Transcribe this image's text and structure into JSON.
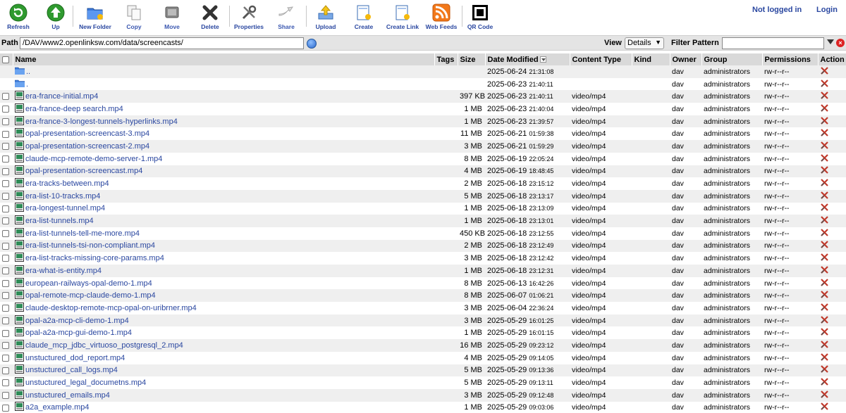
{
  "toolbar": {
    "buttons": [
      {
        "id": "refresh",
        "label": "Refresh",
        "icon": "refresh-icon"
      },
      {
        "id": "up",
        "label": "Up",
        "icon": "up-arrow-icon"
      },
      {
        "id": "new-folder",
        "label": "New Folder",
        "icon": "new-folder-icon"
      },
      {
        "id": "copy",
        "label": "Copy",
        "icon": "copy-icon"
      },
      {
        "id": "move",
        "label": "Move",
        "icon": "move-icon"
      },
      {
        "id": "delete",
        "label": "Delete",
        "icon": "delete-icon"
      },
      {
        "id": "properties",
        "label": "Properties",
        "icon": "properties-icon"
      },
      {
        "id": "share",
        "label": "Share",
        "icon": "share-icon"
      },
      {
        "id": "upload",
        "label": "Upload",
        "icon": "upload-icon"
      },
      {
        "id": "create",
        "label": "Create",
        "icon": "create-file-icon"
      },
      {
        "id": "create-link",
        "label": "Create Link",
        "icon": "create-link-icon"
      },
      {
        "id": "web-feeds",
        "label": "Web Feeds",
        "icon": "rss-icon"
      },
      {
        "id": "qr-code",
        "label": "QR Code",
        "icon": "qr-code-icon"
      }
    ],
    "not_logged_in": "Not logged in",
    "login": "Login"
  },
  "pathbar": {
    "path_label": "Path",
    "path_value": "/DAV/www2.openlinksw.com/data/screencasts/",
    "view_label": "View",
    "view_value": "Details",
    "filter_label": "Filter Pattern",
    "filter_value": ""
  },
  "columns": {
    "name": "Name",
    "tags": "Tags",
    "size": "Size",
    "date": "Date Modified",
    "type": "Content Type",
    "kind": "Kind",
    "owner": "Owner",
    "group": "Group",
    "perms": "Permissions",
    "action": "Action"
  },
  "rows": [
    {
      "name": "..",
      "folder": true,
      "size": "",
      "date": "2025-06-24",
      "time": "21:31:08",
      "type": "",
      "owner": "dav",
      "group": "administrators",
      "perms": "rw-r--r--"
    },
    {
      "name": ".",
      "folder": true,
      "size": "",
      "date": "2025-06-23",
      "time": "21:40:11",
      "type": "",
      "owner": "dav",
      "group": "administrators",
      "perms": "rw-r--r--"
    },
    {
      "name": "era-france-initial.mp4",
      "size": "397 KB",
      "date": "2025-06-23",
      "time": "21:40:11",
      "type": "video/mp4",
      "owner": "dav",
      "group": "administrators",
      "perms": "rw-r--r--"
    },
    {
      "name": "era-france-deep search.mp4",
      "size": "1 MB",
      "date": "2025-06-23",
      "time": "21:40:04",
      "type": "video/mp4",
      "owner": "dav",
      "group": "administrators",
      "perms": "rw-r--r--"
    },
    {
      "name": "era-france-3-longest-tunnels-hyperlinks.mp4",
      "size": "1 MB",
      "date": "2025-06-23",
      "time": "21:39:57",
      "type": "video/mp4",
      "owner": "dav",
      "group": "administrators",
      "perms": "rw-r--r--"
    },
    {
      "name": "opal-presentation-screencast-3.mp4",
      "size": "11 MB",
      "date": "2025-06-21",
      "time": "01:59:38",
      "type": "video/mp4",
      "owner": "dav",
      "group": "administrators",
      "perms": "rw-r--r--"
    },
    {
      "name": "opal-presentation-screencast-2.mp4",
      "size": "3 MB",
      "date": "2025-06-21",
      "time": "01:59:29",
      "type": "video/mp4",
      "owner": "dav",
      "group": "administrators",
      "perms": "rw-r--r--"
    },
    {
      "name": "claude-mcp-remote-demo-server-1.mp4",
      "size": "8 MB",
      "date": "2025-06-19",
      "time": "22:05:24",
      "type": "video/mp4",
      "owner": "dav",
      "group": "administrators",
      "perms": "rw-r--r--"
    },
    {
      "name": "opal-presentation-screencast.mp4",
      "size": "4 MB",
      "date": "2025-06-19",
      "time": "18:48:45",
      "type": "video/mp4",
      "owner": "dav",
      "group": "administrators",
      "perms": "rw-r--r--"
    },
    {
      "name": "era-tracks-between.mp4",
      "size": "2 MB",
      "date": "2025-06-18",
      "time": "23:15:12",
      "type": "video/mp4",
      "owner": "dav",
      "group": "administrators",
      "perms": "rw-r--r--"
    },
    {
      "name": "era-list-10-tracks.mp4",
      "size": "5 MB",
      "date": "2025-06-18",
      "time": "23:13:17",
      "type": "video/mp4",
      "owner": "dav",
      "group": "administrators",
      "perms": "rw-r--r--"
    },
    {
      "name": "era-longest-tunnel.mp4",
      "size": "1 MB",
      "date": "2025-06-18",
      "time": "23:13:09",
      "type": "video/mp4",
      "owner": "dav",
      "group": "administrators",
      "perms": "rw-r--r--"
    },
    {
      "name": "era-list-tunnels.mp4",
      "size": "1 MB",
      "date": "2025-06-18",
      "time": "23:13:01",
      "type": "video/mp4",
      "owner": "dav",
      "group": "administrators",
      "perms": "rw-r--r--"
    },
    {
      "name": "era-list-tunnels-tell-me-more.mp4",
      "size": "450 KB",
      "date": "2025-06-18",
      "time": "23:12:55",
      "type": "video/mp4",
      "owner": "dav",
      "group": "administrators",
      "perms": "rw-r--r--"
    },
    {
      "name": "era-list-tunnels-tsi-non-compliant.mp4",
      "size": "2 MB",
      "date": "2025-06-18",
      "time": "23:12:49",
      "type": "video/mp4",
      "owner": "dav",
      "group": "administrators",
      "perms": "rw-r--r--"
    },
    {
      "name": "era-list-tracks-missing-core-params.mp4",
      "size": "3 MB",
      "date": "2025-06-18",
      "time": "23:12:42",
      "type": "video/mp4",
      "owner": "dav",
      "group": "administrators",
      "perms": "rw-r--r--"
    },
    {
      "name": "era-what-is-entity.mp4",
      "size": "1 MB",
      "date": "2025-06-18",
      "time": "23:12:31",
      "type": "video/mp4",
      "owner": "dav",
      "group": "administrators",
      "perms": "rw-r--r--"
    },
    {
      "name": "european-railways-opal-demo-1.mp4",
      "size": "8 MB",
      "date": "2025-06-13",
      "time": "16:42:26",
      "type": "video/mp4",
      "owner": "dav",
      "group": "administrators",
      "perms": "rw-r--r--"
    },
    {
      "name": "opal-remote-mcp-claude-demo-1.mp4",
      "size": "8 MB",
      "date": "2025-06-07",
      "time": "01:06:21",
      "type": "video/mp4",
      "owner": "dav",
      "group": "administrators",
      "perms": "rw-r--r--"
    },
    {
      "name": "claude-desktop-remote-mcp-opal-on-uribrner.mp4",
      "size": "3 MB",
      "date": "2025-06-04",
      "time": "22:36:24",
      "type": "video/mp4",
      "owner": "dav",
      "group": "administrators",
      "perms": "rw-r--r--"
    },
    {
      "name": "opal-a2a-mcp-cli-demo-1.mp4",
      "size": "3 MB",
      "date": "2025-05-29",
      "time": "16:01:25",
      "type": "video/mp4",
      "owner": "dav",
      "group": "administrators",
      "perms": "rw-r--r--"
    },
    {
      "name": "opal-a2a-mcp-gui-demo-1.mp4",
      "size": "1 MB",
      "date": "2025-05-29",
      "time": "16:01:15",
      "type": "video/mp4",
      "owner": "dav",
      "group": "administrators",
      "perms": "rw-r--r--"
    },
    {
      "name": "claude_mcp_jdbc_virtuoso_postgresql_2.mp4",
      "size": "16 MB",
      "date": "2025-05-29",
      "time": "09:23:12",
      "type": "video/mp4",
      "owner": "dav",
      "group": "administrators",
      "perms": "rw-r--r--"
    },
    {
      "name": "unstuctured_dod_report.mp4",
      "size": "4 MB",
      "date": "2025-05-29",
      "time": "09:14:05",
      "type": "video/mp4",
      "owner": "dav",
      "group": "administrators",
      "perms": "rw-r--r--"
    },
    {
      "name": "unstuctured_call_logs.mp4",
      "size": "5 MB",
      "date": "2025-05-29",
      "time": "09:13:36",
      "type": "video/mp4",
      "owner": "dav",
      "group": "administrators",
      "perms": "rw-r--r--"
    },
    {
      "name": "unstuctured_legal_documetns.mp4",
      "size": "5 MB",
      "date": "2025-05-29",
      "time": "09:13:11",
      "type": "video/mp4",
      "owner": "dav",
      "group": "administrators",
      "perms": "rw-r--r--"
    },
    {
      "name": "unstuctured_emails.mp4",
      "size": "3 MB",
      "date": "2025-05-29",
      "time": "09:12:48",
      "type": "video/mp4",
      "owner": "dav",
      "group": "administrators",
      "perms": "rw-r--r--"
    },
    {
      "name": "a2a_example.mp4",
      "size": "1 MB",
      "date": "2025-05-29",
      "time": "09:03:06",
      "type": "video/mp4",
      "owner": "dav",
      "group": "administrators",
      "perms": "rw-r--r--"
    }
  ]
}
